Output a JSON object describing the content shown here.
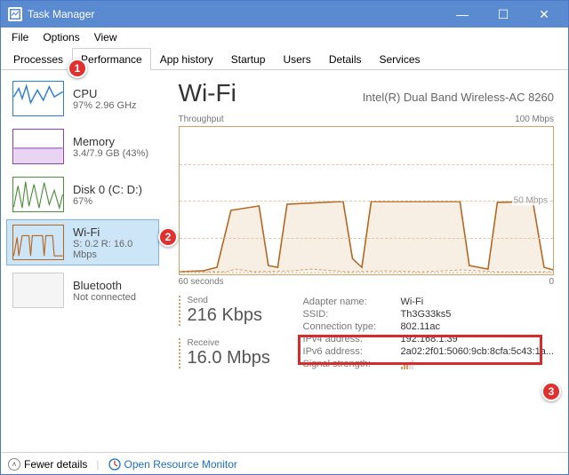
{
  "window": {
    "title": "Task Manager"
  },
  "menu": {
    "file": "File",
    "options": "Options",
    "view": "View"
  },
  "tabs": {
    "processes": "Processes",
    "performance": "Performance",
    "appHistory": "App history",
    "startup": "Startup",
    "users": "Users",
    "details": "Details",
    "services": "Services"
  },
  "sidebar": {
    "cpu": {
      "title": "CPU",
      "sub": "97%  2.96 GHz"
    },
    "mem": {
      "title": "Memory",
      "sub": "3.4/7.9 GB (43%)"
    },
    "disk": {
      "title": "Disk 0 (C: D:)",
      "sub": "67%"
    },
    "wifi": {
      "title": "Wi-Fi",
      "sub": "S: 0.2 R: 16.0 Mbps"
    },
    "bt": {
      "title": "Bluetooth",
      "sub": "Not connected"
    }
  },
  "main": {
    "title": "Wi-Fi",
    "adapter": "Intel(R) Dual Band Wireless-AC 8260",
    "throughputLabel": "Throughput",
    "maxLabel": "100 Mbps",
    "midLabel": "50 Mbps",
    "timeLabel": "60 seconds",
    "zeroLabel": "0",
    "send": {
      "label": "Send",
      "value": "216 Kbps"
    },
    "recv": {
      "label": "Receive",
      "value": "16.0 Mbps"
    },
    "details": {
      "adapterKey": "Adapter name:",
      "adapterVal": "Wi-Fi",
      "ssidKey": "SSID:",
      "ssidVal": "Th3G33ks5",
      "connKey": "Connection type:",
      "connVal": "802.11ac",
      "ipv4Key": "IPv4 address:",
      "ipv4Val": "192.168.1.39",
      "ipv6Key": "IPv6 address:",
      "ipv6Val": "2a02:2f01:5060:9cb:8cfa:5c43:1a...",
      "sigKey": "Signal strength:"
    }
  },
  "footer": {
    "fewer": "Fewer details",
    "orm": "Open Resource Monitor"
  },
  "callouts": {
    "one": "1",
    "two": "2",
    "three": "3"
  },
  "chart_data": {
    "type": "line",
    "title": "Wi-Fi Throughput",
    "xlabel": "seconds",
    "ylabel": "Mbps",
    "ylim": [
      0,
      100
    ],
    "x_range_seconds": 60,
    "series": [
      {
        "name": "Receive",
        "values": [
          2,
          2,
          3,
          4,
          40,
          45,
          45,
          42,
          10,
          5,
          48,
          50,
          50,
          50,
          48,
          45,
          15,
          8,
          48,
          50,
          50,
          50,
          50,
          50,
          50,
          50,
          50,
          48,
          45,
          10,
          5,
          4,
          4,
          3,
          50,
          50,
          50,
          50,
          48,
          5,
          3,
          2
        ]
      },
      {
        "name": "Send",
        "values": [
          1,
          1,
          1,
          1,
          2,
          1,
          1,
          1,
          1,
          1,
          2,
          1,
          1,
          2,
          1,
          1,
          1,
          1,
          2,
          1,
          1,
          1,
          1,
          1,
          1,
          1,
          1,
          1,
          1,
          1,
          1,
          1,
          1,
          1,
          2,
          1,
          1,
          1,
          1,
          1,
          1,
          1
        ]
      }
    ]
  }
}
